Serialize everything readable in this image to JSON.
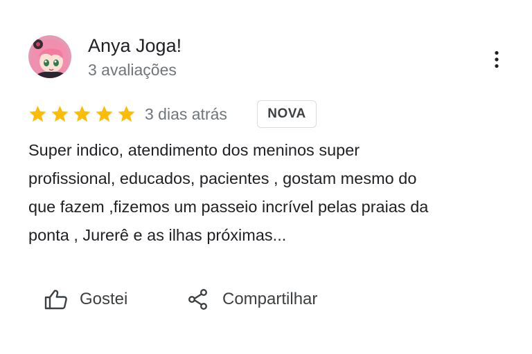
{
  "reviewer": {
    "name": "Anya Joga!",
    "review_count": "3 avaliações"
  },
  "rating": {
    "stars": 5,
    "max_stars": 5,
    "star_color": "#fbbc04"
  },
  "review": {
    "date": "3 dias atrás",
    "badge": "NOVA",
    "text_lines": [
      "Super indico, atendimento dos meninos super",
      "profissional, educados, pacientes , gostam mesmo do",
      "que fazem ,fizemos um passeio incrível pelas praias da",
      "ponta , Jurerê e as ilhas próximas..."
    ]
  },
  "actions": {
    "like_label": "Gostei",
    "share_label": "Compartilhar",
    "like_icon": "thumbs-up-icon",
    "share_icon": "share-icon",
    "more_icon": "more-vert-icon"
  }
}
